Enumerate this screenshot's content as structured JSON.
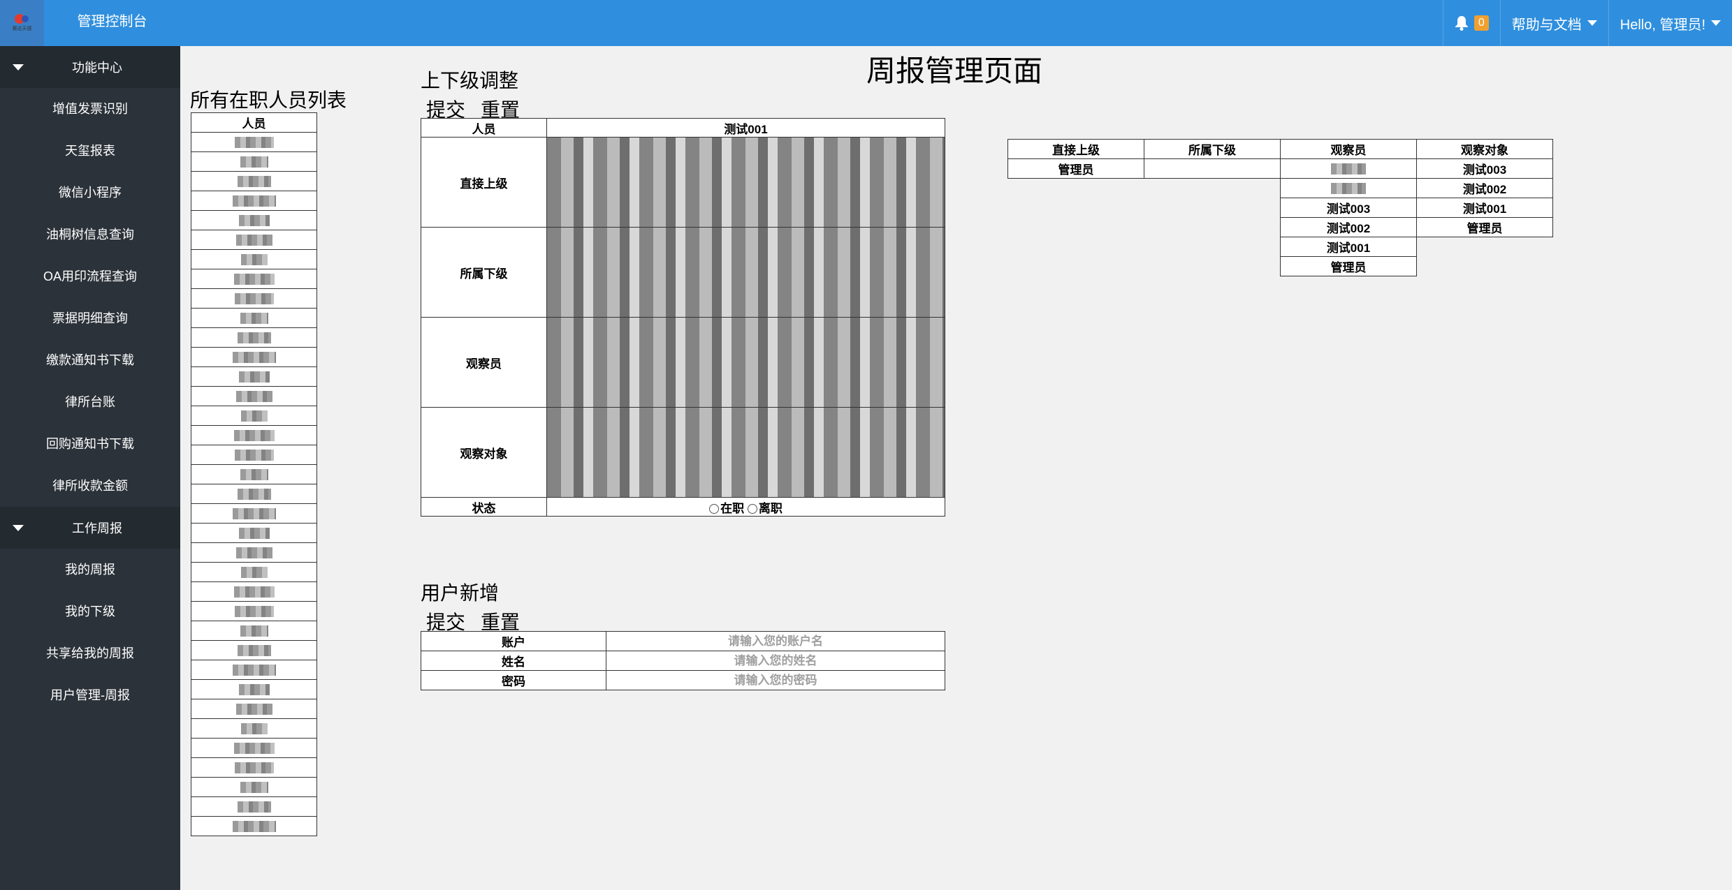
{
  "header": {
    "logo_text": "赛达天德",
    "app_title": "管理控制台",
    "notification_count": "0",
    "help_label": "帮助与文档",
    "user_greeting": "Hello, 管理员!"
  },
  "sidebar": {
    "groups": [
      {
        "label": "功能中心",
        "items": [
          "增值发票识别",
          "天玺报表",
          "微信小程序",
          "油桐树信息查询",
          "OA用印流程查询",
          "票据明细查询",
          "缴款通知书下载",
          "律所台账",
          "回购通知书下载",
          "律所收款金额"
        ]
      },
      {
        "label": "工作周报",
        "items": [
          "我的周报",
          "我的下级",
          "共享给我的周报",
          "用户管理-周报"
        ]
      }
    ]
  },
  "page": {
    "title": "周报管理页面"
  },
  "people_list": {
    "heading": "所有在职人员列表",
    "column_header": "人员",
    "row_count": 36
  },
  "adjust": {
    "heading": "上下级调整",
    "submit_label": "提交",
    "reset_label": "重置",
    "person_label": "人员",
    "person_value": "测试001",
    "rows": [
      "直接上级",
      "所属下级",
      "观察员",
      "观察对象"
    ],
    "status_label": "状态",
    "status_options": [
      "在职",
      "离职"
    ]
  },
  "relations": {
    "headers": [
      "直接上级",
      "所属下级",
      "观察员",
      "观察对象"
    ],
    "rows": [
      [
        "管理员",
        "",
        "",
        "测试003"
      ],
      [
        "",
        "",
        "",
        "测试002"
      ],
      [
        "",
        "",
        "测试003",
        "测试001"
      ],
      [
        "",
        "",
        "测试002",
        "管理员"
      ],
      [
        "",
        "",
        "测试001",
        ""
      ],
      [
        "",
        "",
        "管理员",
        ""
      ]
    ]
  },
  "new_user": {
    "heading": "用户新增",
    "submit_label": "提交",
    "reset_label": "重置",
    "fields": [
      {
        "label": "账户",
        "placeholder": "请输入您的账户名"
      },
      {
        "label": "姓名",
        "placeholder": "请输入您的姓名"
      },
      {
        "label": "密码",
        "placeholder": "请输入您的密码"
      }
    ]
  }
}
